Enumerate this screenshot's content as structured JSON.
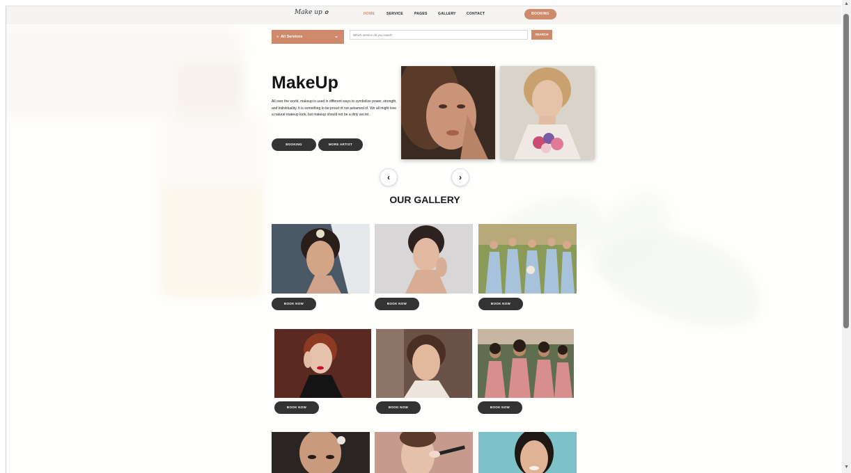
{
  "header": {
    "logo": "Make up",
    "nav": [
      "HOME",
      "SERVICE",
      "PAGES",
      "GALLERY",
      "CONTACT"
    ],
    "active_nav": "HOME",
    "booking_label": "BOOKING"
  },
  "search": {
    "category_label": "All Services",
    "placeholder": "Which service do you need?",
    "button_label": "SEARCH"
  },
  "hero": {
    "title": "MakeUp",
    "description": "All over the world, makeup is used in different ways to symbolize power, strength, and individuality. It is something to be proud of not ashamed of. We all might love a natural makeup look, but makeup should not be a dirty secret.",
    "booking_label": "BOOKING",
    "more_artist_label": "MORE ARTIST"
  },
  "carousel": {
    "prev_icon": "‹",
    "next_icon": "›"
  },
  "gallery": {
    "title": "OUR GALLERY",
    "book_label": "BOOK NOW"
  },
  "colors": {
    "accent": "#cf8a6c",
    "dark_button": "#333333"
  },
  "icons": [
    "menu-icon",
    "chevron-down-icon",
    "chevron-left-icon",
    "chevron-right-icon"
  ]
}
